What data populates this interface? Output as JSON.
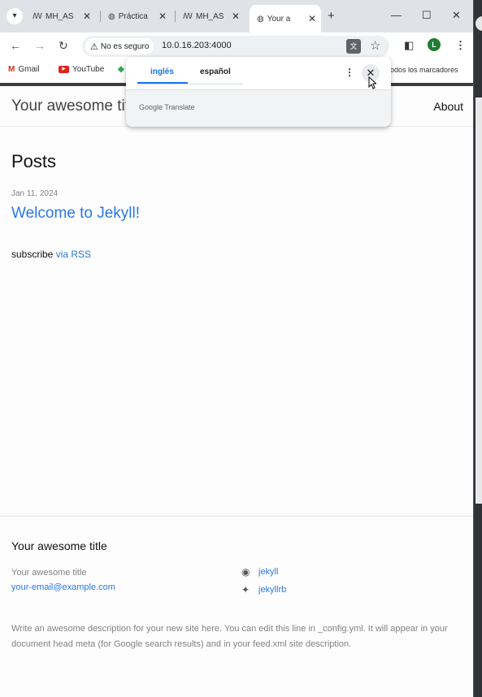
{
  "browser": {
    "tabs": [
      {
        "label": "MH_AS",
        "icon": "site-icon"
      },
      {
        "label": "Práctica",
        "icon": "globe-icon"
      },
      {
        "label": "MH_AS",
        "icon": "site-icon"
      },
      {
        "label": "Your a",
        "icon": "globe-icon",
        "active": true
      }
    ],
    "security_label": "No es seguro",
    "url": "10.0.16.203:4000",
    "profile_initial": "L",
    "bookmarks": [
      {
        "label": "Gmail",
        "icon": "gmail-icon"
      },
      {
        "label": "YouTube",
        "icon": "youtube-icon"
      }
    ],
    "all_bookmarks_label": "odos los marcadores"
  },
  "translate_popup": {
    "source_lang": "inglés",
    "target_lang": "español",
    "powered_by": "Google Translate"
  },
  "site": {
    "title": "Your awesome title",
    "nav": {
      "about": "About"
    },
    "posts_heading": "Posts",
    "posts": [
      {
        "date": "Jan 11, 2024",
        "title": "Welcome to Jekyll!"
      }
    ],
    "subscribe_text": "subscribe",
    "subscribe_link": "via RSS",
    "footer": {
      "heading": "Your awesome title",
      "name": "Your awesome title",
      "email": "your-email@example.com",
      "github": "jekyll",
      "twitter": "jekyllrb",
      "description": "Write an awesome description for your new site here. You can edit this line in _config.yml. It will appear in your document head meta (for Google search results) and in your feed.xml site description."
    }
  },
  "colors": {
    "link": "#2a7ae2",
    "accent": "#1a73e8",
    "tab_strip": "#dfe3e7"
  }
}
